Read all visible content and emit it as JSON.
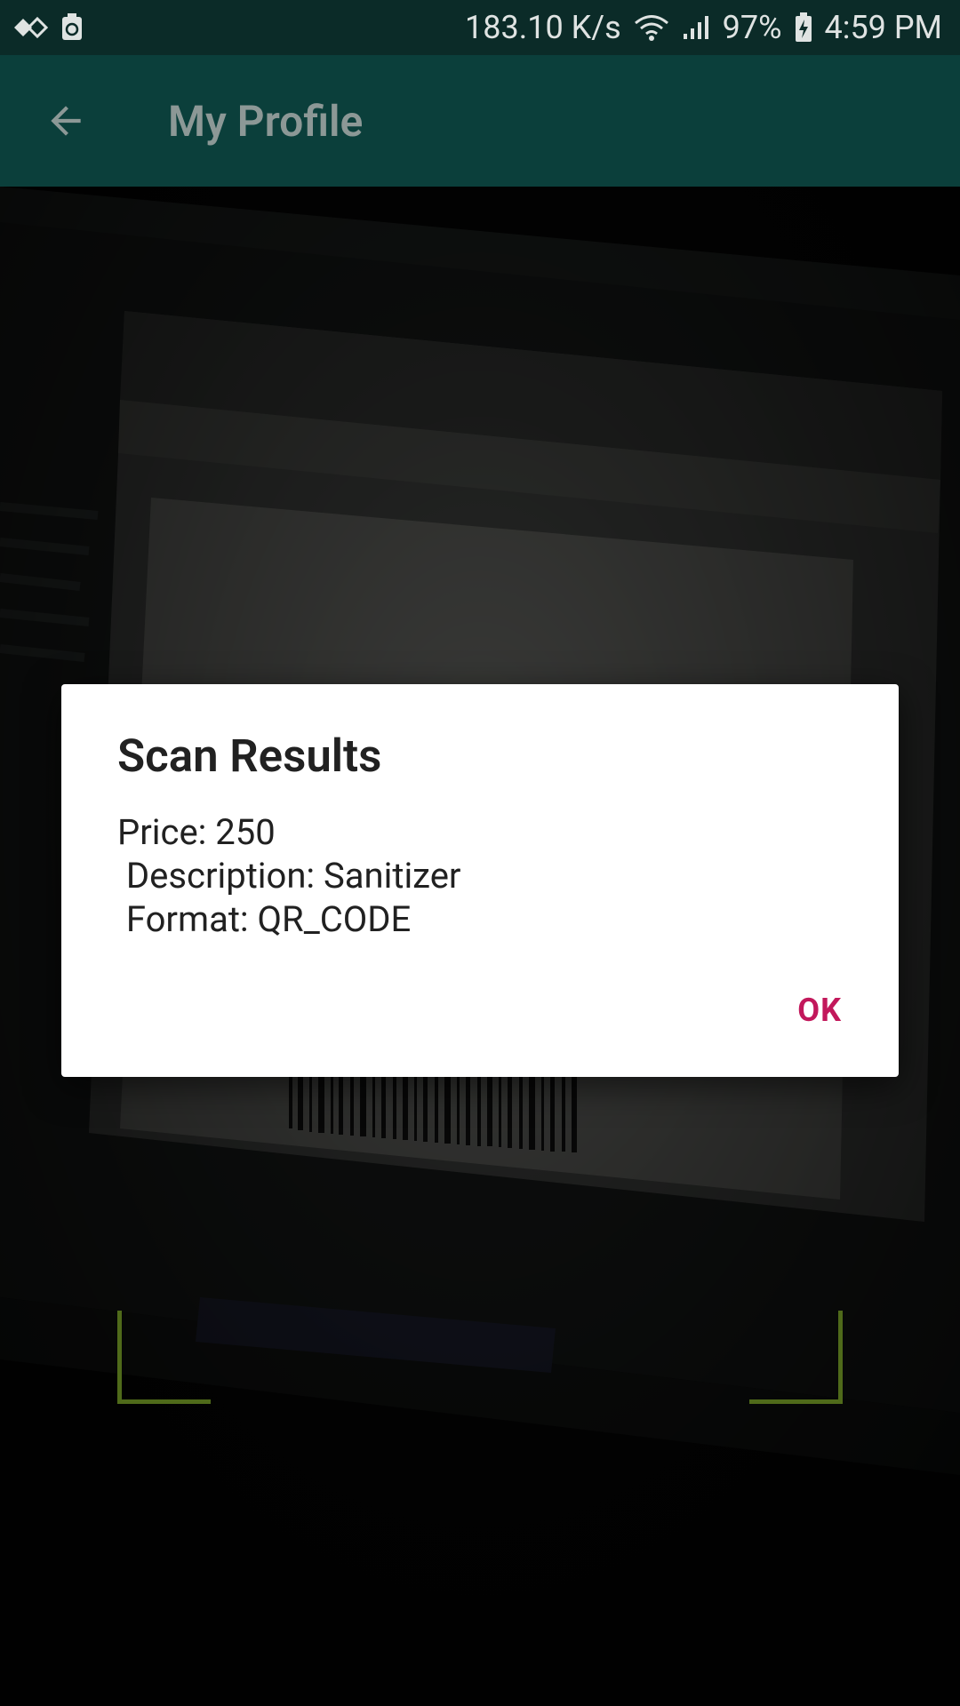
{
  "status_bar": {
    "net_speed": "183.10 K/s",
    "battery": "97%",
    "time": "4:59 PM",
    "icons": [
      "sync-icon",
      "recycle-icon",
      "wifi-icon",
      "signal-icon",
      "battery-charging-icon"
    ]
  },
  "app_bar": {
    "title": "My Profile",
    "back_icon": "arrow-back-icon"
  },
  "dialog": {
    "title": "Scan Results",
    "line1": "Price: 250",
    "line2": " Description: Sanitizer",
    "line3": " Format: QR_CODE",
    "ok_label": "OK"
  },
  "colors": {
    "status_bar_bg": "#0b2b28",
    "app_bar_bg": "#0b3f3b",
    "dialog_accent": "#c2185b",
    "scan_frame": "#4f6a1a"
  }
}
